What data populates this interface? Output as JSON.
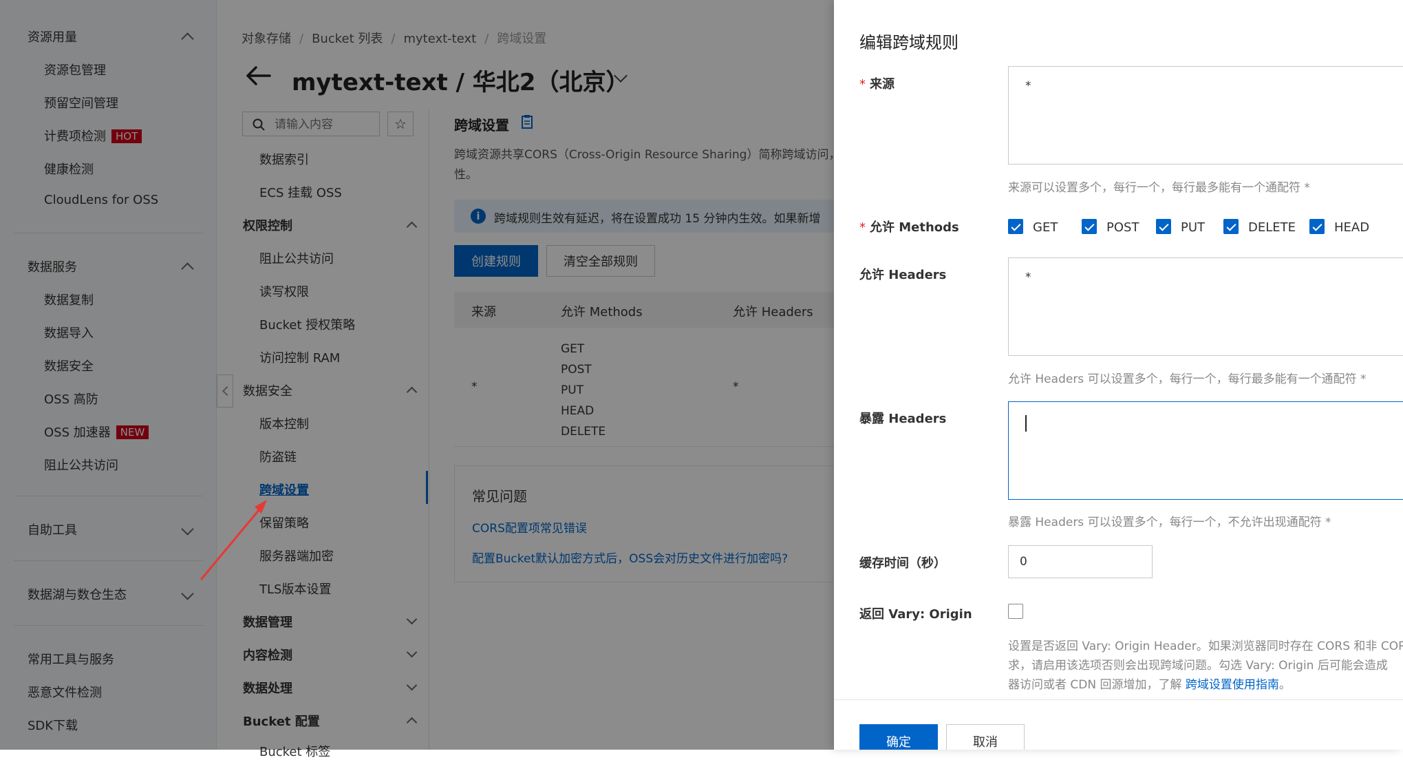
{
  "left_nav": {
    "groups": [
      {
        "label": "资源用量",
        "items": [
          "资源包管理",
          "预留空间管理",
          "计费项检测",
          "健康检测",
          "CloudLens for OSS"
        ]
      },
      {
        "label": "数据服务",
        "items": [
          "数据复制",
          "数据导入",
          "数据安全",
          "OSS 高防",
          "OSS 加速器",
          "阻止公共访问"
        ]
      },
      {
        "label": "自助工具"
      },
      {
        "label": "数据湖与数仓生态"
      }
    ],
    "bottom_items": [
      "常用工具与服务",
      "恶意文件检测",
      "SDK下载"
    ],
    "badges": {
      "hot": "HOT",
      "new": "NEW"
    }
  },
  "breadcrumb": [
    "对象存储",
    "Bucket 列表",
    "mytext-text",
    "跨域设置"
  ],
  "bucket_title": "mytext-text / 华北2（北京）",
  "search": {
    "placeholder": "请输入内容"
  },
  "sub_nav": {
    "top_items": [
      "数据索引",
      "ECS 挂载 OSS"
    ],
    "perm_group": "权限控制",
    "perm_items": [
      "阻止公共访问",
      "读写权限",
      "Bucket 授权策略",
      "访问控制 RAM"
    ],
    "sec_group": "数据安全",
    "sec_items": [
      "版本控制",
      "防盗链",
      "跨域设置",
      "保留策略",
      "服务器端加密",
      "TLS版本设置"
    ],
    "more_groups": [
      "数据管理",
      "内容检测",
      "数据处理",
      "Bucket 配置"
    ],
    "cut_item": "Bucket 标签"
  },
  "main": {
    "title": "跨域设置",
    "desc_line1": "跨域资源共享CORS（Cross-Origin Resource Sharing）简称跨域访问，",
    "desc_line2": "性。",
    "notice": "跨域规则生效有延迟，将在设置成功 15 分钟内生效。如果新增",
    "create_btn": "创建规则",
    "clear_btn": "清空全部规则",
    "table_headers": [
      "来源",
      "允许 Methods",
      "允许 Headers"
    ],
    "row": {
      "source": "*",
      "methods": [
        "GET",
        "POST",
        "PUT",
        "HEAD",
        "DELETE"
      ],
      "headers": "*"
    },
    "faq_title": "常见问题",
    "faq_links": [
      "CORS配置项常见错误",
      "配置Bucket默认加密方式后，OSS会对历史文件进行加密吗?"
    ]
  },
  "drawer": {
    "title": "编辑跨域规则",
    "source_label": "来源",
    "source_value": "*",
    "source_hint": "来源可以设置多个，每行一个，每行最多能有一个通配符 *",
    "methods_label": "允许 Methods",
    "methods": [
      "GET",
      "POST",
      "PUT",
      "DELETE",
      "HEAD"
    ],
    "headers_label": "允许 Headers",
    "headers_value": "*",
    "headers_hint": "允许 Headers 可以设置多个，每行一个，每行最多能有一个通配符 *",
    "expose_label": "暴露 Headers",
    "expose_value": "",
    "expose_hint": "暴露 Headers 可以设置多个，每行一个，不允许出现通配符 *",
    "cache_label": "缓存时间（秒）",
    "cache_value": "0",
    "vary_label": "返回 Vary: Origin",
    "vary_desc1": "设置是否返回 Vary: Origin Header。如果浏览器同时存在 CORS 和非 COR",
    "vary_desc2": "求，请启用该选项否则会出现跨域问题。勾选 Vary: Origin 后可能会造成",
    "vary_desc3_pre": "器访问或者 CDN 回源增加，了解 ",
    "vary_link": "跨域设置使用指南",
    "vary_desc3_post": "。",
    "ok_btn": "确定",
    "cancel_btn": "取消"
  },
  "colors": {
    "primary": "#0064c8",
    "badge": "#d0021b",
    "annotation_arrow": "#e53935"
  }
}
